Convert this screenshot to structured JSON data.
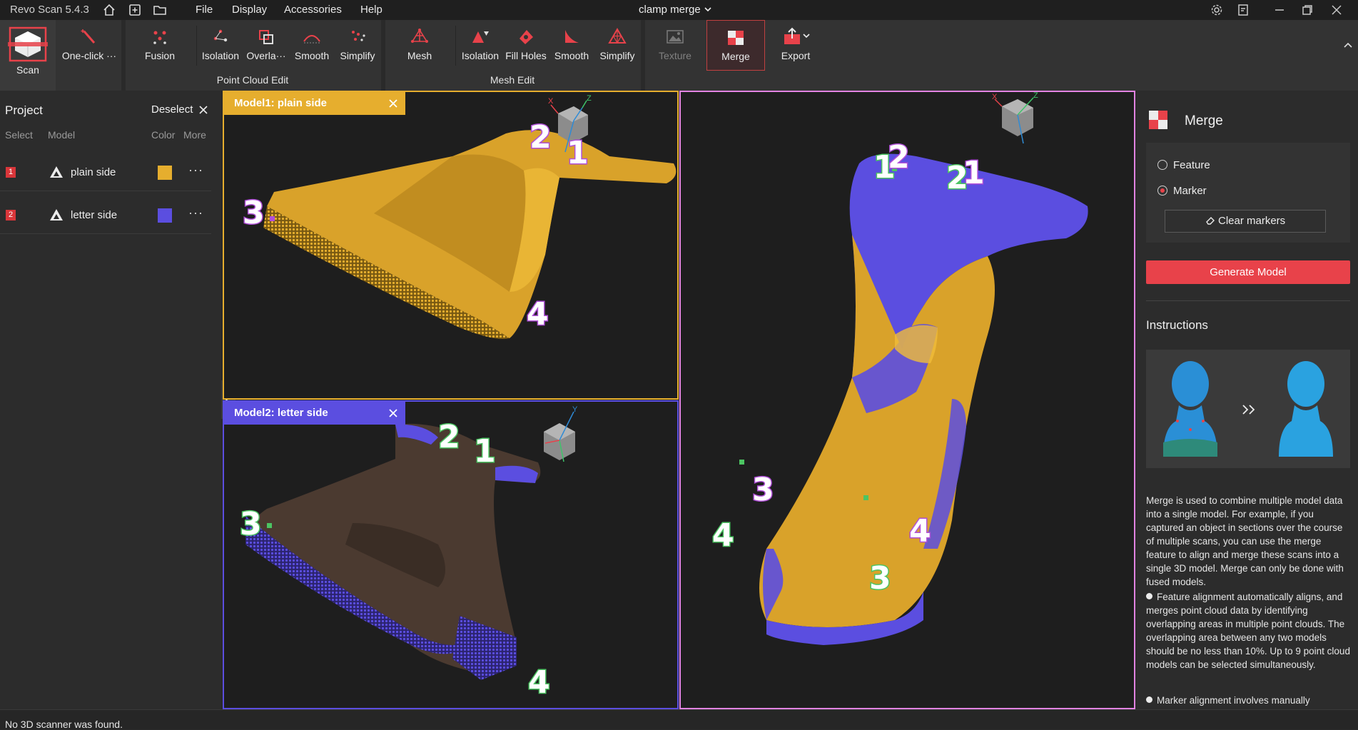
{
  "app": {
    "name": "Revo Scan 5.4.3",
    "document_title": "clamp merge"
  },
  "menu": [
    "File",
    "Display",
    "Accessories",
    "Help"
  ],
  "toolbar": {
    "scan": "Scan",
    "one_click": "One-click ···",
    "point_cloud_edit": {
      "label": "Point Cloud Edit",
      "tools": [
        "Fusion",
        "Isolation",
        "Overla···",
        "Smooth",
        "Simplify"
      ]
    },
    "mesh_edit": {
      "label": "Mesh Edit",
      "tools": [
        "Mesh",
        "Isolation",
        "Fill Holes",
        "Smooth",
        "Simplify"
      ]
    },
    "texture": "Texture",
    "merge": "Merge",
    "export": "Export"
  },
  "project": {
    "title": "Project",
    "deselect": "Deselect",
    "columns": [
      "Select",
      "Model",
      "Color",
      "More"
    ],
    "models": [
      {
        "index": "1",
        "name": "plain side",
        "color": "#e6ae2e",
        "more": "···"
      },
      {
        "index": "2",
        "name": "letter side",
        "color": "#5b4ee0",
        "more": "···"
      }
    ]
  },
  "viewports": {
    "model1": {
      "tag": "Model1: plain side",
      "markers": [
        "1",
        "2",
        "3",
        "4"
      ]
    },
    "model2": {
      "tag": "Model2: letter side",
      "markers": [
        "1",
        "2",
        "3",
        "4"
      ]
    },
    "merged": {
      "markers_a": [
        "1",
        "2",
        "3",
        "4"
      ],
      "markers_b": [
        "1",
        "2",
        "3",
        "4"
      ]
    }
  },
  "colors": {
    "model1": "#e6ae2e",
    "model2": "#5b4ee0",
    "accent": "#e8424a",
    "marker_purple": "#b04fd8",
    "marker_green": "#4cc462"
  },
  "merge_panel": {
    "title": "Merge",
    "options": [
      {
        "label": "Feature",
        "selected": false
      },
      {
        "label": "Marker",
        "selected": true
      }
    ],
    "clear_markers": "Clear markers",
    "generate": "Generate Model",
    "instructions_title": "Instructions",
    "intro": "Merge is used to combine multiple model data into a single model. For example, if you captured an object in sections over the course of multiple scans, you can use the merge feature to align and merge these scans into a single 3D model. Merge can only be done with fused models.",
    "bullets": [
      "Feature alignment automatically aligns, and merges point cloud data by identifying overlapping areas in multiple point clouds. The overlapping area between any two models should be no less than 10%. Up to 9 point cloud models can be selected simultaneously.",
      "Marker alignment involves manually"
    ]
  },
  "status": "No 3D scanner was found."
}
